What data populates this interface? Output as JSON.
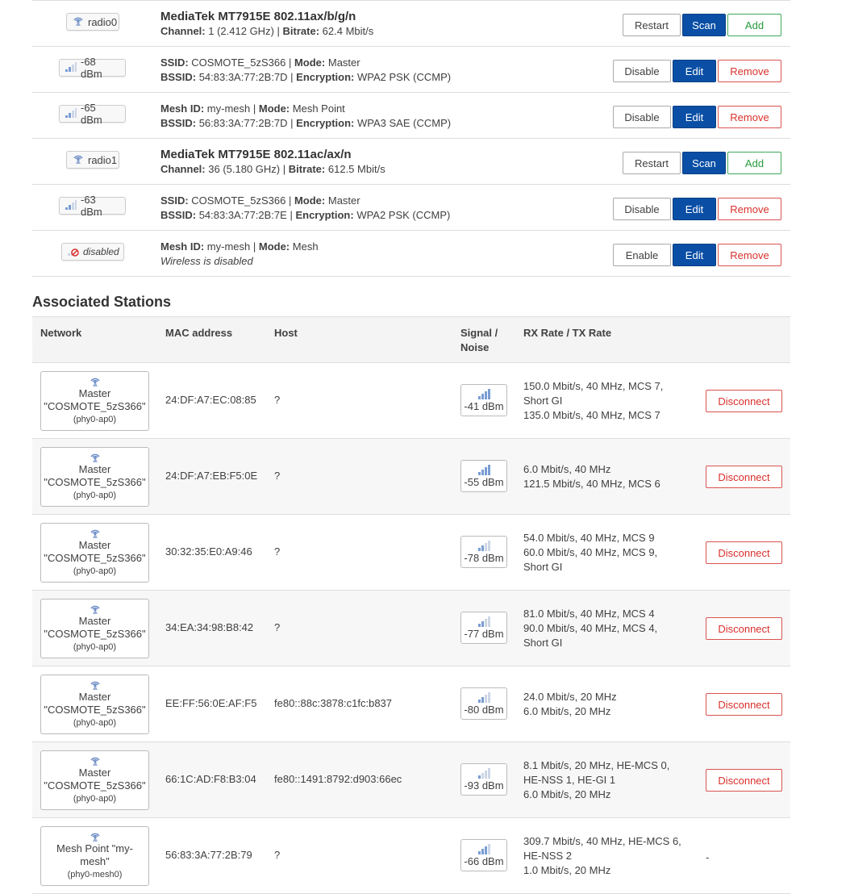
{
  "wireless": [
    {
      "kind": "radio",
      "badge": "radio0",
      "title": "MediaTek MT7915E 802.11ax/b/g/n",
      "ch_label": "Channel:",
      "ch": "1 (2.412 GHz)",
      "br_label": "Bitrate:",
      "br": "62.4 Mbit/s",
      "buttons": [
        "Restart",
        "Scan",
        "Add"
      ]
    },
    {
      "kind": "net",
      "badge": "-68 dBm",
      "l1k": "SSID:",
      "l1v": "COSMOTE_5zS366",
      "l1k2": "Mode:",
      "l1v2": "Master",
      "l2k": "BSSID:",
      "l2v": "54:83:3A:77:2B:7D",
      "l2k2": "Encryption:",
      "l2v2": "WPA2 PSK (CCMP)",
      "buttons": [
        "Disable",
        "Edit",
        "Remove"
      ]
    },
    {
      "kind": "net",
      "badge": "-65 dBm",
      "l1k": "Mesh ID:",
      "l1v": "my-mesh",
      "l1k2": "Mode:",
      "l1v2": "Mesh Point",
      "l2k": "BSSID:",
      "l2v": "56:83:3A:77:2B:7D",
      "l2k2": "Encryption:",
      "l2v2": "WPA3 SAE (CCMP)",
      "buttons": [
        "Disable",
        "Edit",
        "Remove"
      ]
    },
    {
      "kind": "radio",
      "badge": "radio1",
      "title": "MediaTek MT7915E 802.11ac/ax/n",
      "ch_label": "Channel:",
      "ch": "36 (5.180 GHz)",
      "br_label": "Bitrate:",
      "br": "612.5 Mbit/s",
      "buttons": [
        "Restart",
        "Scan",
        "Add"
      ]
    },
    {
      "kind": "net",
      "badge": "-63 dBm",
      "l1k": "SSID:",
      "l1v": "COSMOTE_5zS366",
      "l1k2": "Mode:",
      "l1v2": "Master",
      "l2k": "BSSID:",
      "l2v": "54:83:3A:77:2B:7E",
      "l2k2": "Encryption:",
      "l2v2": "WPA2 PSK (CCMP)",
      "buttons": [
        "Disable",
        "Edit",
        "Remove"
      ]
    },
    {
      "kind": "disabled",
      "badge": "disabled",
      "l1k": "Mesh ID:",
      "l1v": "my-mesh",
      "l1k2": "Mode:",
      "l1v2": "Mesh",
      "l2": "Wireless is disabled",
      "buttons": [
        "Enable",
        "Edit",
        "Remove"
      ]
    }
  ],
  "stations": {
    "title": "Associated Stations",
    "headers": {
      "network": "Network",
      "mac": "MAC address",
      "host": "Host",
      "signal": "Signal /",
      "noise": "Noise",
      "rate": "RX Rate / TX Rate"
    },
    "rows": [
      {
        "net1": "Master",
        "net2": "\"COSMOTE_5zS366\"",
        "net3": "(phy0-ap0)",
        "mac": "24:DF:A7:EC:08:85",
        "host": "?",
        "signal": "-41 dBm",
        "bars": 4,
        "rates": [
          "150.0 Mbit/s, 40 MHz, MCS 7,",
          "Short GI",
          "135.0 Mbit/s, 40 MHz, MCS 7"
        ],
        "action": "Disconnect"
      },
      {
        "net1": "Master",
        "net2": "\"COSMOTE_5zS366\"",
        "net3": "(phy0-ap0)",
        "mac": "24:DF:A7:EB:F5:0E",
        "host": "?",
        "signal": "-55 dBm",
        "bars": 4,
        "rates": [
          "6.0 Mbit/s, 40 MHz",
          "121.5 Mbit/s, 40 MHz, MCS 6"
        ],
        "action": "Disconnect"
      },
      {
        "net1": "Master",
        "net2": "\"COSMOTE_5zS366\"",
        "net3": "(phy0-ap0)",
        "mac": "30:32:35:E0:A9:46",
        "host": "?",
        "signal": "-78 dBm",
        "bars": 2,
        "rates": [
          "54.0 Mbit/s, 40 MHz, MCS 9",
          "60.0 Mbit/s, 40 MHz, MCS 9,",
          "Short GI"
        ],
        "action": "Disconnect"
      },
      {
        "net1": "Master",
        "net2": "\"COSMOTE_5zS366\"",
        "net3": "(phy0-ap0)",
        "mac": "34:EA:34:98:B8:42",
        "host": "?",
        "signal": "-77 dBm",
        "bars": 2,
        "rates": [
          "81.0 Mbit/s, 40 MHz, MCS 4",
          "90.0 Mbit/s, 40 MHz, MCS 4,",
          "Short GI"
        ],
        "action": "Disconnect"
      },
      {
        "net1": "Master",
        "net2": "\"COSMOTE_5zS366\"",
        "net3": "(phy0-ap0)",
        "mac": "EE:FF:56:0E:AF:F5",
        "host": "fe80::88c:3878:c1fc:b837",
        "signal": "-80 dBm",
        "bars": 2,
        "rates": [
          "24.0 Mbit/s, 20 MHz",
          "6.0 Mbit/s, 20 MHz"
        ],
        "action": "Disconnect"
      },
      {
        "net1": "Master",
        "net2": "\"COSMOTE_5zS366\"",
        "net3": "(phy0-ap0)",
        "mac": "66:1C:AD:F8:B3:04",
        "host": "fe80::1491:8792:d903:66ec",
        "signal": "-93 dBm",
        "bars": 1,
        "rates": [
          "8.1 Mbit/s, 20 MHz, HE-MCS 0,",
          "HE-NSS 1, HE-GI 1",
          "6.0 Mbit/s, 20 MHz"
        ],
        "action": "Disconnect"
      },
      {
        "net1": "Mesh Point \"my-",
        "net2": "mesh\"",
        "net3": "(phy0-mesh0)",
        "mac": "56:83:3A:77:2B:79",
        "host": "?",
        "signal": "-66 dBm",
        "bars": 3,
        "rates": [
          "309.7 Mbit/s, 40 MHz, HE-MCS 6,",
          "HE-NSS 2",
          "1.0 Mbit/s, 20 MHz"
        ],
        "action": "-"
      }
    ]
  }
}
